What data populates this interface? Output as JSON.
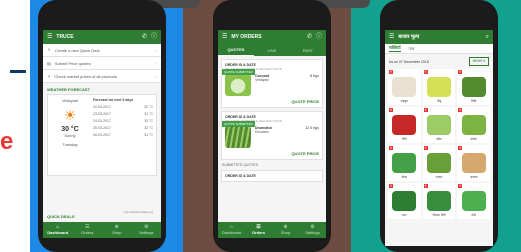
{
  "colors": {
    "brand_green": "#2e7d32",
    "panel_blue": "#1e88e5",
    "panel_brown": "#6d4c41",
    "panel_teal": "#14a08e",
    "accent_red": "#e53935"
  },
  "page": {
    "edge_glyph": "e"
  },
  "phone1": {
    "app_title": "TRUCE",
    "menu_items": [
      {
        "label": "Create a new Quick Deal",
        "icon": "plus-icon"
      },
      {
        "label": "Submit Price quotes",
        "icon": "document-icon"
      },
      {
        "label": "Check market prices of all products",
        "icon": "trend-icon"
      }
    ],
    "forecast_title": "WEATHER FORECAST",
    "forecast": {
      "location": "Vellayani",
      "temperature": "30 °C",
      "condition": "Sunny",
      "day": "Tuesday",
      "header": "Forecast for next 5 days",
      "days": [
        "22-03-2017",
        "23-03-2017",
        "24-03-2017",
        "25-03-2017",
        "26-03-2017"
      ],
      "temps": [
        "32 °C",
        "31 °C",
        "33 °C",
        "32 °C",
        "31 °C"
      ]
    },
    "credit": "OpenWeatherMap.org",
    "bar_label": "QUICK DEALS",
    "nav": [
      "Dashboard",
      "Orders",
      "Shop",
      "Settings"
    ]
  },
  "phone2": {
    "app_title": "MY ORDERS",
    "tabs": [
      "QUOTES",
      "LIVE",
      "PAST"
    ],
    "orders": [
      {
        "header": "ORDER ID & DATE",
        "sub": "DELIVERY ADDRESS & DELIVERY DATE",
        "badge": "QUOTE SUBMITTED",
        "name": "Coconut",
        "qty": "8 Kgs",
        "place": "Vellayani",
        "action": "QUOTE PRICE"
      },
      {
        "header": "ORDER ID & DATE",
        "sub": "DELIVERY ADDRESS & DELIVERY DATE",
        "badge": "QUOTE SUBMITTED",
        "name": "Drumstick",
        "qty": "12.5 Kgs",
        "place": "Kovalam",
        "action": "QUOTE PRICE"
      }
    ],
    "section_label": "SUBMITTED QUOTES",
    "third_order_header": "ORDER ID & DATE",
    "nav": [
      "Dashboard",
      "Orders",
      "Shop",
      "Settings"
    ]
  },
  "phone3": {
    "app_title": "बाजार मूल्य",
    "sub_tabs": [
      "सब्जियाँ",
      "फल"
    ],
    "date_label": "As on 07 December 2018",
    "district": "कोल्लम",
    "products": [
      {
        "name": "लहसुन",
        "tag": "₹",
        "color": "#e8e0d0"
      },
      {
        "name": "नींबू",
        "tag": "₹",
        "color": "#d4e157"
      },
      {
        "name": "भिंडी",
        "tag": "₹",
        "color": "#558b2f"
      },
      {
        "name": "मिर्च",
        "tag": "₹",
        "color": "#c62828"
      },
      {
        "name": "खीरा",
        "tag": "₹",
        "color": "#9ccc65"
      },
      {
        "name": "करेला",
        "tag": "₹",
        "color": "#7cb342"
      },
      {
        "name": "बीन्स",
        "tag": "₹",
        "color": "#43a047"
      },
      {
        "name": "परवल",
        "tag": "₹",
        "color": "#689f38"
      },
      {
        "name": "अदरक",
        "tag": "₹",
        "color": "#d7a86e"
      },
      {
        "name": "मटर",
        "tag": "₹",
        "color": "#2e7d32"
      },
      {
        "name": "शिमला मिर्च",
        "tag": "₹",
        "color": "#388e3c"
      },
      {
        "name": "मेथी",
        "tag": "₹",
        "color": "#4caf50"
      }
    ]
  }
}
